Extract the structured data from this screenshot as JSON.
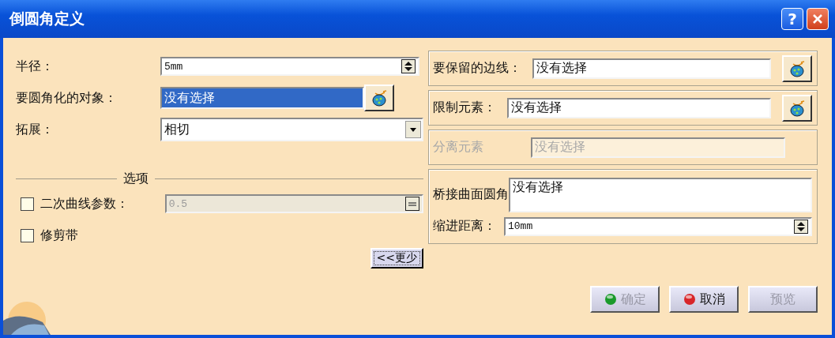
{
  "window": {
    "title": "倒圆角定义"
  },
  "title_buttons": [
    {
      "kind": "help",
      "label": "?"
    },
    {
      "kind": "close"
    }
  ],
  "fields": [
    {
      "kind": "spinner",
      "label": "半径：",
      "value": "5mm"
    },
    {
      "kind": "selector",
      "label": "要圆角化的对象：",
      "value": "没有选择",
      "selected": true
    },
    {
      "kind": "dropdown",
      "label": "拓展：",
      "value": "相切"
    }
  ],
  "options": {
    "title": "选项",
    "items": [
      {
        "kind": "spinner",
        "label": "二次曲线参数：",
        "checked": false,
        "value": "0.5",
        "disabled": true
      },
      {
        "kind": "checkbox",
        "label": "修剪带",
        "checked": false
      }
    ]
  },
  "more_button": "<<更少",
  "right_groups": [
    {
      "kind": "selector",
      "label": "要保留的边线：",
      "value": "没有选择",
      "disabled": false
    },
    {
      "kind": "selector",
      "label": "限制元素：",
      "value": "没有选择",
      "disabled": false
    },
    {
      "kind": "plain",
      "label": "分离元素",
      "value": "没有选择",
      "disabled": true
    },
    {
      "kind": "bridge",
      "label": "桥接曲面圆角",
      "value": "没有选择",
      "sub": {
        "label": "缩进距离：",
        "value": "10mm"
      }
    }
  ],
  "buttons": [
    {
      "kind": "ok",
      "label": "确定",
      "disabled": true
    },
    {
      "kind": "cancel",
      "label": "取消",
      "disabled": false
    },
    {
      "kind": "preview",
      "label": "预览",
      "disabled": true
    }
  ]
}
